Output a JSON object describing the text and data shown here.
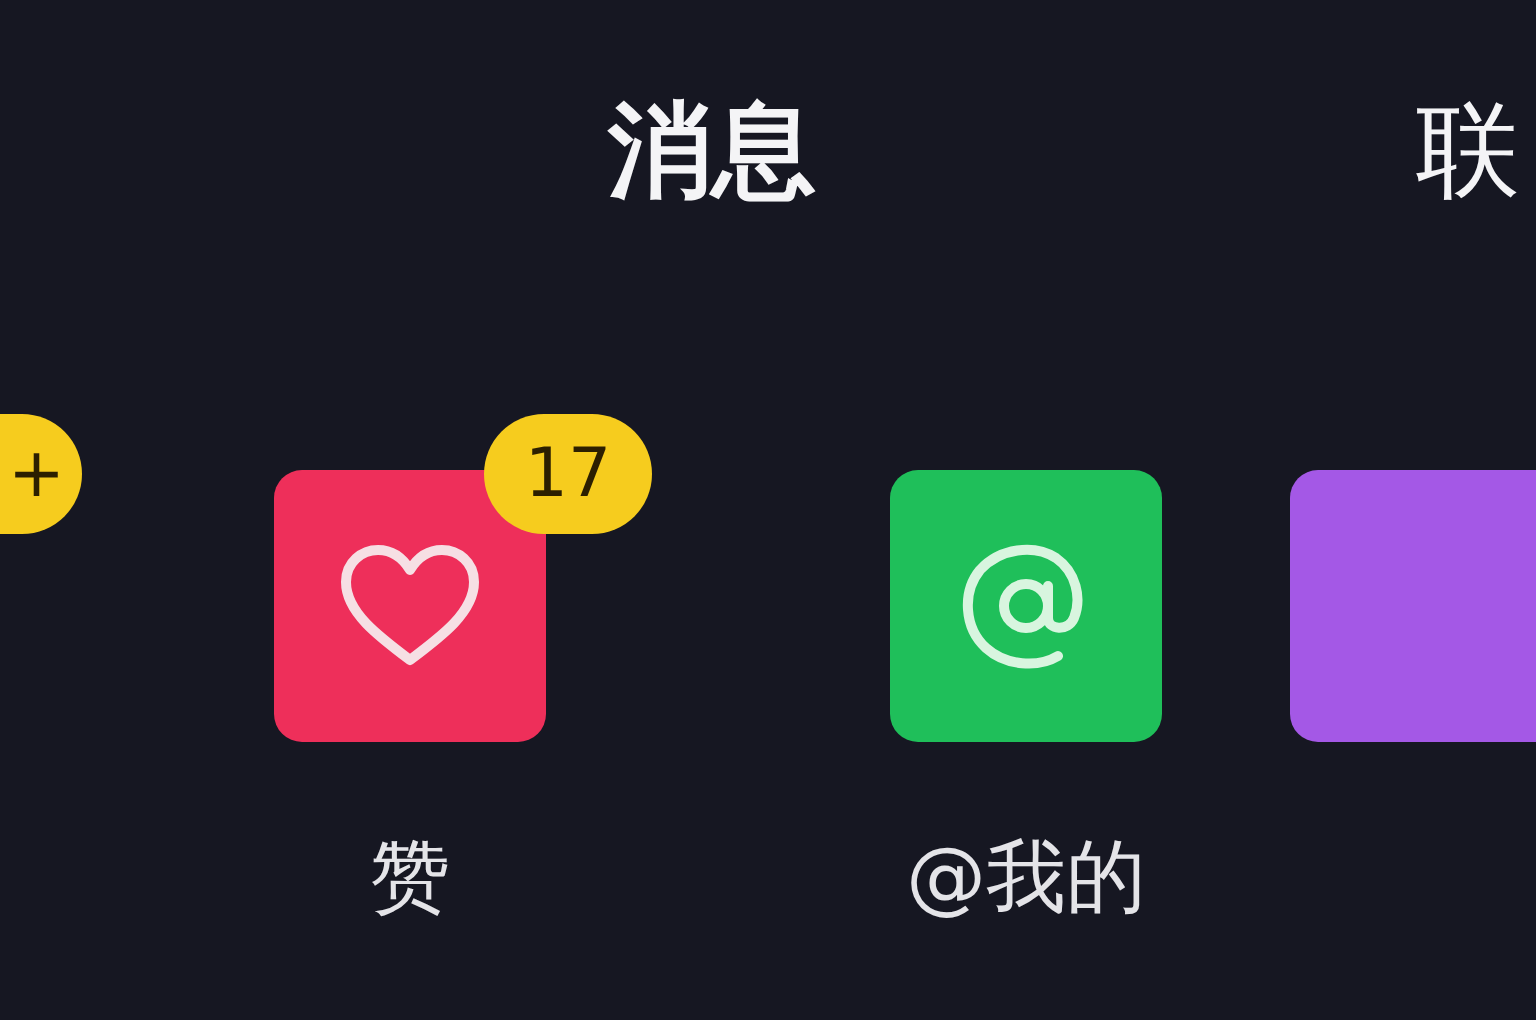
{
  "titles": [
    "消息",
    "联"
  ],
  "shortcuts": [
    {
      "kind": "offscreen",
      "badge": "+"
    },
    {
      "kind": "likes",
      "label": "赞",
      "badge": "17",
      "color": "#ee2f5a"
    },
    {
      "kind": "mentions",
      "label": "@我的",
      "color": "#1fbf5a"
    },
    {
      "kind": "partial",
      "color": "#a458e6"
    }
  ]
}
